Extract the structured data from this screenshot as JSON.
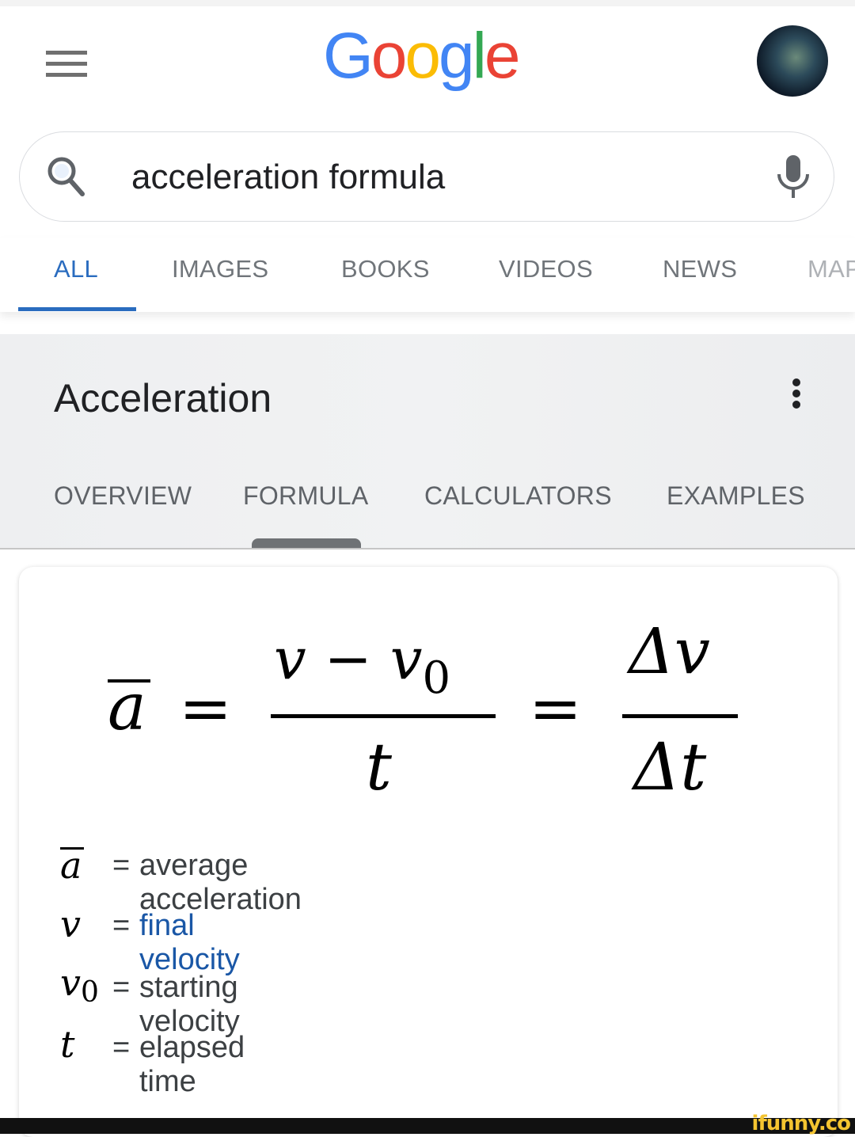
{
  "header": {
    "logo": {
      "letters": [
        "G",
        "o",
        "o",
        "g",
        "l",
        "e"
      ],
      "colors": [
        "#4285f4",
        "#ea4335",
        "#fbbc05",
        "#4285f4",
        "#34a853",
        "#ea4335"
      ]
    }
  },
  "search": {
    "value": "acceleration formula",
    "placeholder": ""
  },
  "tabs": [
    {
      "label": "ALL",
      "active": true
    },
    {
      "label": "IMAGES"
    },
    {
      "label": "BOOKS"
    },
    {
      "label": "VIDEOS"
    },
    {
      "label": "NEWS"
    },
    {
      "label": "MAPS"
    }
  ],
  "knowledge_panel": {
    "title": "Acceleration",
    "sub_tabs": [
      {
        "label": "OVERVIEW"
      },
      {
        "label": "FORMULA",
        "active": true
      },
      {
        "label": "CALCULATORS"
      },
      {
        "label": "EXAMPLES"
      }
    ]
  },
  "formula": {
    "lhs": "a",
    "equals": "=",
    "num1": "v − v",
    "num1_sub": "0",
    "den1": "t",
    "num2": "Δv",
    "den2": "Δt",
    "legend": [
      {
        "symbol": "a",
        "overline": true,
        "eq": "=",
        "desc": "average acceleration",
        "link": false
      },
      {
        "symbol": "v",
        "eq": "=",
        "desc": "final velocity",
        "link": true
      },
      {
        "symbol": "v",
        "sub": "0",
        "eq": "=",
        "desc": "starting velocity",
        "link": false
      },
      {
        "symbol": "t",
        "eq": "=",
        "desc": "elapsed time",
        "link": false
      }
    ]
  },
  "watermark": "ifunny.co",
  "colors": {
    "accent": "#2a6cbf",
    "link": "#1a57a6",
    "text": "#202124",
    "muted": "#70757a"
  }
}
